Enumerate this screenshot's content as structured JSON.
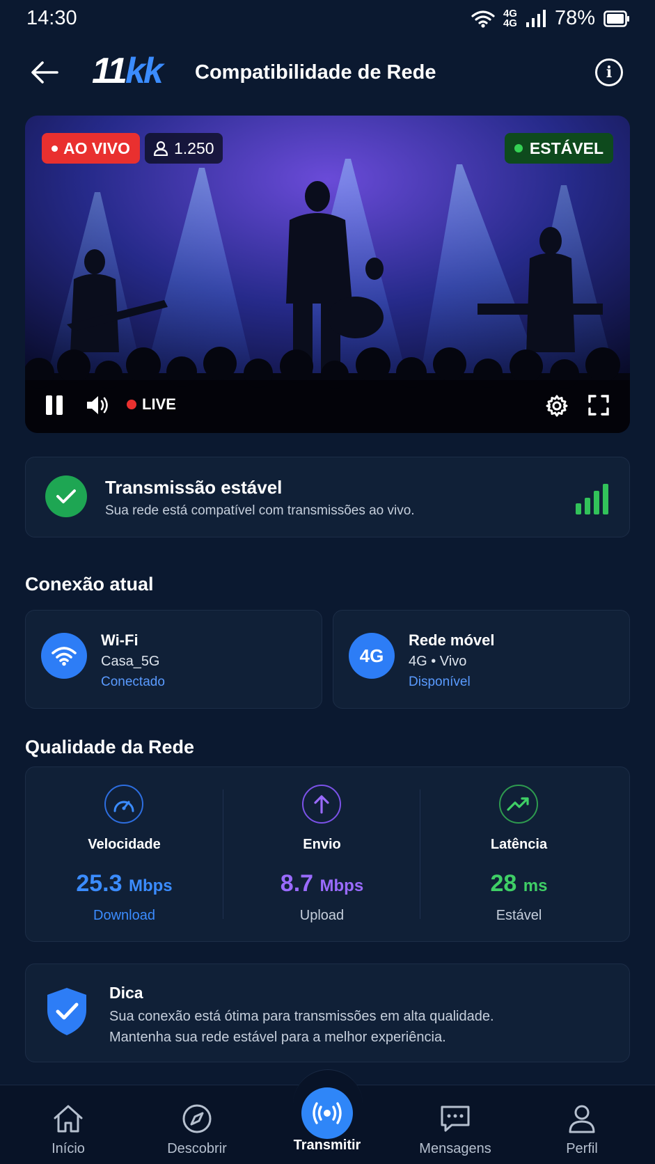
{
  "status_bar": {
    "time": "14:30",
    "network_top": "4G",
    "network_bottom": "4G",
    "battery": "78%"
  },
  "header": {
    "logo_num": "11",
    "logo_kk": "kk",
    "title": "Compatibilidade de Rede"
  },
  "video": {
    "live_badge": "AO VIVO",
    "viewers": "1.250",
    "stability_badge": "ESTÁVEL",
    "live_indicator": "LIVE"
  },
  "stable_card": {
    "title": "Transmissão estável",
    "subtitle": "Sua rede está compatível com transmissões ao vivo.",
    "signal_level": 4,
    "accent": "#32c25a"
  },
  "connection": {
    "section_title": "Conexão atual",
    "wifi": {
      "title": "Wi-Fi",
      "network": "Casa_5G",
      "status": "Conectado"
    },
    "mobile": {
      "icon_text": "4G",
      "title": "Rede móvel",
      "network": "4G • Vivo",
      "status": "Disponível"
    }
  },
  "quality": {
    "section_title": "Qualidade da Rede",
    "speed": {
      "label": "Velocidade",
      "value": "25.3",
      "unit": "Mbps",
      "sub": "Download",
      "color": "#3b8cff"
    },
    "upload": {
      "label": "Envio",
      "value": "8.7",
      "unit": "Mbps",
      "sub": "Upload",
      "color": "#9a6bff"
    },
    "latency": {
      "label": "Latência",
      "value": "28",
      "unit": "ms",
      "sub": "Estável",
      "color": "#3fcf66"
    }
  },
  "tip": {
    "title": "Dica",
    "line1": "Sua conexão está ótima para transmissões em alta qualidade.",
    "line2": "Mantenha sua rede estável para a melhor experiência."
  },
  "nav": {
    "home": "Início",
    "discover": "Descobrir",
    "broadcast": "Transmitir",
    "messages": "Mensagens",
    "profile": "Perfil"
  }
}
